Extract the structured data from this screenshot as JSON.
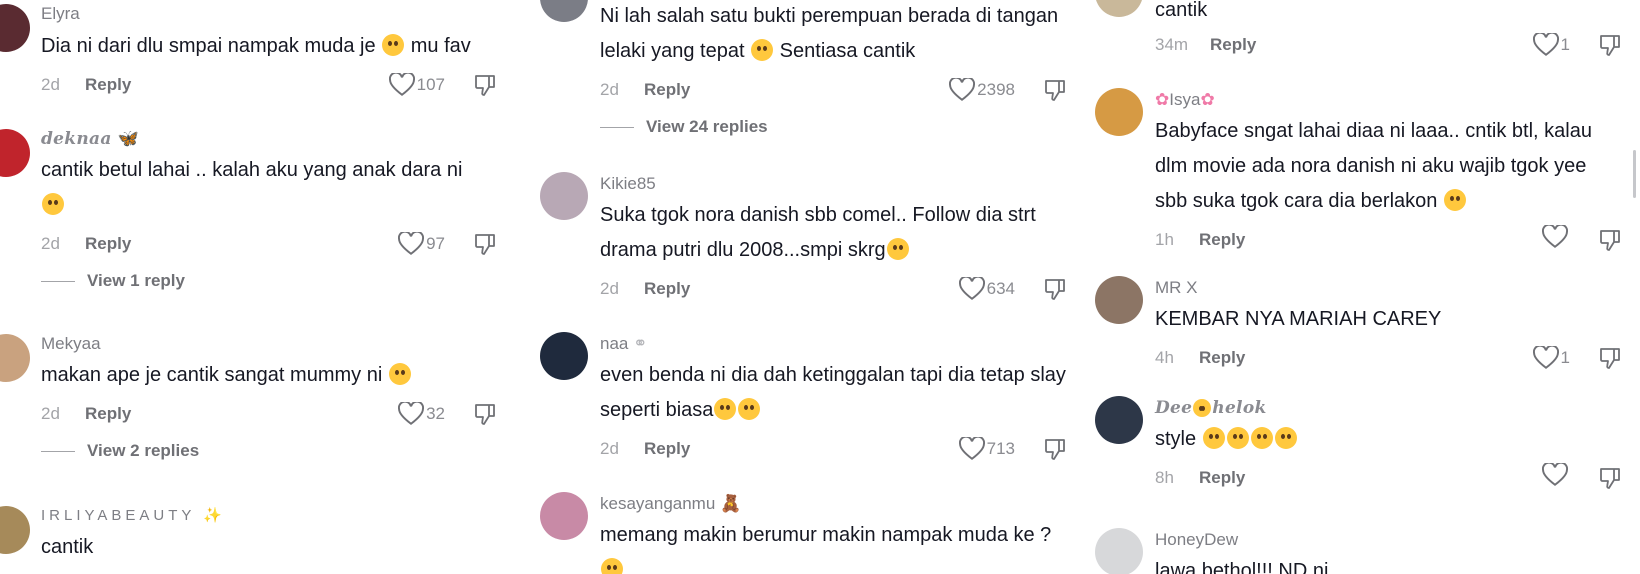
{
  "columns": [
    {
      "comments": [
        {
          "username": "Elyra",
          "text": "Dia ni dari dlu smpai nampak muda je",
          "emoji": "pleading-face",
          "text_after": "mu fav",
          "time": "2d",
          "reply": "Reply",
          "likes": "107",
          "avatar_color": "#5a2b31"
        },
        {
          "username": "deknaa",
          "username_emoji": "butterfly",
          "text": "cantik betul lahai .. kalah aku yang anak dara ni",
          "emoji": "laughing-tears",
          "time": "2d",
          "reply": "Reply",
          "likes": "97",
          "view_replies": "View 1 reply",
          "avatar_color": "#c0242c"
        },
        {
          "username": "Mekyaa",
          "text": "makan ape je cantik sangat mummy ni",
          "emoji": "pleading-face",
          "time": "2d",
          "reply": "Reply",
          "likes": "32",
          "view_replies": "View 2 replies",
          "avatar_color": "#c9a27f"
        },
        {
          "username": "IRLIYABEAUTY",
          "username_emoji": "sparkles",
          "text": "cantik",
          "avatar_color": "#a68a5a"
        }
      ]
    },
    {
      "comments": [
        {
          "text": "Ni lah salah satu bukti perempuan berada di tangan lelaki yang tepat",
          "emoji": "smiling-hearts",
          "text_after": "Sentiasa cantik",
          "time": "2d",
          "reply": "Reply",
          "likes": "2398",
          "view_replies": "View 24 replies",
          "avatar_color": "#7b7d86"
        },
        {
          "username": "Kikie85",
          "text": "Suka tgok nora danish sbb comel.. Follow dia strt drama putri dlu 2008...smpi skrg",
          "emoji": "smiling-hearts",
          "time": "2d",
          "reply": "Reply",
          "likes": "634",
          "avatar_color": "#b8a8b5"
        },
        {
          "username": "naa",
          "username_emoji": "rings",
          "text": "even benda ni dia dah ketinggalan tapi dia tetap slay seperti biasa",
          "emoji": "weary-face-x2",
          "time": "2d",
          "reply": "Reply",
          "likes": "713",
          "avatar_color": "#1f2a3d"
        },
        {
          "username": "kesayanganmu",
          "username_emoji": "teddy-bear",
          "text": "memang makin berumur makin nampak muda ke ?",
          "emoji": "flushed-face",
          "avatar_color": "#c88aa6"
        }
      ]
    },
    {
      "comments": [
        {
          "text": "cantik",
          "time": "34m",
          "reply": "Reply",
          "likes": "1",
          "avatar_color": "#c9b89a"
        },
        {
          "username": "Isya",
          "username_emoji": "cherry-blossom",
          "text": "Babyface sngat lahai diaa ni laaa.. cntik btl, kalau dlm movie ada nora danish ni aku wajib tgok yee sbb suka tgok cara dia berlakon",
          "emoji": "laughing-tears",
          "time": "1h",
          "reply": "Reply",
          "likes": "",
          "avatar_color": "#d69a44"
        },
        {
          "username": "MR X",
          "text": "KEMBAR NYA MARIAH CAREY",
          "time": "4h",
          "reply": "Reply",
          "likes": "1",
          "avatar_color": "#8c7565"
        },
        {
          "username": "Dee",
          "username_mid_emoji": "nerd-face",
          "username_after": "helok",
          "text": "style",
          "emoji": "smiling-hearts-x4",
          "time": "8h",
          "reply": "Reply",
          "likes": "",
          "avatar_color": "#2d3748"
        },
        {
          "username": "HoneyDew",
          "text": "lawa bethol!!! ND ni",
          "avatar_color": "#d7d8da"
        }
      ]
    }
  ],
  "colors": {
    "text": "#161823",
    "secondary": "#7d7e84",
    "emoji": "#ffc83d",
    "heart": "#8a8b90"
  }
}
